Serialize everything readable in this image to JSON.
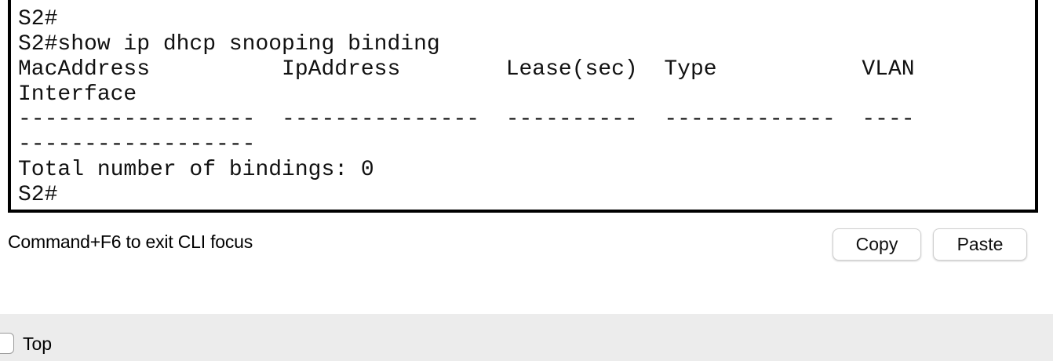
{
  "terminal": {
    "lines": [
      "S2#",
      "S2#",
      "S2#show ip dhcp snooping binding",
      "MacAddress          IpAddress        Lease(sec)  Type           VLAN",
      "Interface",
      "------------------  ---------------  ----------  -------------  ----",
      "------------------",
      "Total number of bindings: 0",
      "S2#"
    ]
  },
  "footer": {
    "hint": "Command+F6 to exit CLI focus",
    "copy_label": "Copy",
    "paste_label": "Paste"
  },
  "bottom_bar": {
    "top_label": "Top",
    "top_checked": false
  }
}
